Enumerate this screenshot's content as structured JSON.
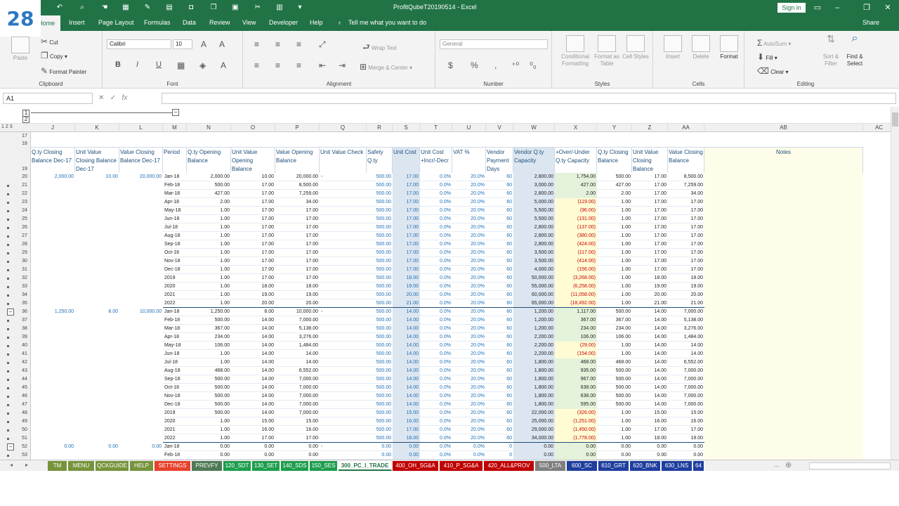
{
  "badge": "28",
  "window": {
    "title": "ProfitQubeT20190514  -  Excel",
    "sign_in": "Sign in"
  },
  "ribbon_tabs": [
    "Home",
    "Insert",
    "Page Layout",
    "Formulas",
    "Data",
    "Review",
    "View",
    "Developer",
    "Help"
  ],
  "tell_me": "Tell me what you want to do",
  "share": "Share",
  "clipboard": {
    "paste": "Paste",
    "cut": "Cut",
    "copy": "Copy",
    "format_painter": "Format Painter",
    "label": "Clipboard"
  },
  "font": {
    "name": "Calibri",
    "size": "10",
    "bold": "B",
    "italic": "I",
    "underline": "U",
    "label": "Font"
  },
  "alignment": {
    "wrap": "Wrap Text",
    "merge": "Merge & Center",
    "label": "Alignment"
  },
  "number": {
    "format": "General",
    "currency": "$",
    "percent": "%",
    "comma": ",",
    "label": "Number"
  },
  "styles": {
    "conditional": "Conditional Formatting",
    "format_table": "Format as Table",
    "cell_styles": "Cell Styles",
    "label": "Styles"
  },
  "cells": {
    "insert": "Insert",
    "delete": "Delete",
    "format": "Format",
    "label": "Cells"
  },
  "editing": {
    "autosum": "AutoSum",
    "fill": "Fill",
    "clear": "Clear",
    "sort": "Sort & Filter",
    "find": "Find & Select",
    "label": "Editing"
  },
  "formula_bar": {
    "name_box": "A1",
    "fx": "fx"
  },
  "outline_levels": [
    "1",
    "2",
    "3"
  ],
  "columns": [
    "J",
    "K",
    "L",
    "M",
    "N",
    "O",
    "P",
    "Q",
    "R",
    "S",
    "T",
    "U",
    "V",
    "W",
    "X",
    "Y",
    "Z",
    "AA",
    "AB",
    "AC"
  ],
  "rows": [
    "17",
    "18",
    "19",
    "20",
    "21",
    "22",
    "23",
    "24",
    "25",
    "26",
    "27",
    "28",
    "29",
    "30",
    "31",
    "32",
    "33",
    "34",
    "35",
    "36",
    "37",
    "38",
    "39",
    "40",
    "41",
    "42",
    "43",
    "44",
    "45",
    "46",
    "47",
    "48",
    "49",
    "50",
    "51",
    "52",
    "53"
  ],
  "headers": [
    "Q.ty Closing Balance Dec-17",
    "Unit Value Closing Balance Dec-17",
    "Value Closing Balance Dec-17",
    "Period",
    "Q.ty Opening Balance",
    "Unit Value Opening Balance",
    "Value Opening Balance",
    "Unit Value Check",
    "Safety Q.ty",
    "Unit Cost",
    "Unit Cost +Incr/-Decr",
    "VAT %",
    "Vendor Payment Days",
    "Vendor Q.ty Capacity",
    "+Over/-Under Q.ty Capacity",
    "Q.ty Closing Balance",
    "Unit Value Closing Balance",
    "Value Closing Balance",
    "Notes"
  ],
  "data_rows": [
    [
      "2,000.00",
      "10.00",
      "20,000.00",
      "Jan-18",
      "2,000.00",
      "10.00",
      "20,000.00",
      "-",
      "500.00",
      "17.00",
      "0.0%",
      "20.0%",
      "60",
      "2,800.00",
      "1,754.00",
      "500.00",
      "17.00",
      "8,500.00"
    ],
    [
      "",
      "",
      "",
      "Feb-18",
      "500.00",
      "17.00",
      "8,500.00",
      "",
      "500.00",
      "17.00",
      "0.0%",
      "20.0%",
      "60",
      "3,000.00",
      "427.00",
      "427.00",
      "17.00",
      "7,259.00"
    ],
    [
      "",
      "",
      "",
      "Mar-18",
      "427.00",
      "17.00",
      "7,259.00",
      "",
      "500.00",
      "17.00",
      "0.0%",
      "20.0%",
      "60",
      "2,800.00",
      "2.00",
      "2.00",
      "17.00",
      "34.00"
    ],
    [
      "",
      "",
      "",
      "Apr-18",
      "2.00",
      "17.00",
      "34.00",
      "",
      "500.00",
      "17.00",
      "0.0%",
      "20.0%",
      "60",
      "5,000.00",
      "(119.00)",
      "1.00",
      "17.00",
      "17.00"
    ],
    [
      "",
      "",
      "",
      "May-18",
      "1.00",
      "17.00",
      "17.00",
      "",
      "500.00",
      "17.00",
      "0.0%",
      "20.0%",
      "60",
      "5,500.00",
      "(96.00)",
      "1.00",
      "17.00",
      "17.00"
    ],
    [
      "",
      "",
      "",
      "Jun-18",
      "1.00",
      "17.00",
      "17.00",
      "",
      "500.00",
      "17.00",
      "0.0%",
      "20.0%",
      "60",
      "5,500.00",
      "(131.00)",
      "1.00",
      "17.00",
      "17.00"
    ],
    [
      "",
      "",
      "",
      "Jul-18",
      "1.00",
      "17.00",
      "17.00",
      "",
      "500.00",
      "17.00",
      "0.0%",
      "20.0%",
      "60",
      "2,800.00",
      "(137.00)",
      "1.00",
      "17.00",
      "17.00"
    ],
    [
      "",
      "",
      "",
      "Aug-18",
      "1.00",
      "17.00",
      "17.00",
      "",
      "500.00",
      "17.00",
      "0.0%",
      "20.0%",
      "60",
      "2,800.00",
      "(380.00)",
      "1.00",
      "17.00",
      "17.00"
    ],
    [
      "",
      "",
      "",
      "Sep-18",
      "1.00",
      "17.00",
      "17.00",
      "",
      "500.00",
      "17.00",
      "0.0%",
      "20.0%",
      "60",
      "2,800.00",
      "(424.00)",
      "1.00",
      "17.00",
      "17.00"
    ],
    [
      "",
      "",
      "",
      "Oct-18",
      "1.00",
      "17.00",
      "17.00",
      "",
      "500.00",
      "17.00",
      "0.0%",
      "20.0%",
      "60",
      "3,500.00",
      "(117.00)",
      "1.00",
      "17.00",
      "17.00"
    ],
    [
      "",
      "",
      "",
      "Nov-18",
      "1.00",
      "17.00",
      "17.00",
      "",
      "500.00",
      "17.00",
      "0.0%",
      "20.0%",
      "60",
      "3,500.00",
      "(414.00)",
      "1.00",
      "17.00",
      "17.00"
    ],
    [
      "",
      "",
      "",
      "Dec-18",
      "1.00",
      "17.00",
      "17.00",
      "",
      "500.00",
      "17.00",
      "0.0%",
      "20.0%",
      "60",
      "4,000.00",
      "(156.00)",
      "1.00",
      "17.00",
      "17.00"
    ],
    [
      "",
      "",
      "",
      "2019",
      "1.00",
      "17.00",
      "17.00",
      "",
      "500.00",
      "18.00",
      "0.0%",
      "20.0%",
      "60",
      "50,000.00",
      "(3,268.00)",
      "1.00",
      "18.00",
      "18.00"
    ],
    [
      "",
      "",
      "",
      "2020",
      "1.00",
      "18.00",
      "18.00",
      "",
      "500.00",
      "19.00",
      "0.0%",
      "20.0%",
      "60",
      "55,000.00",
      "(6,258.00)",
      "1.00",
      "19.00",
      "19.00"
    ],
    [
      "",
      "",
      "",
      "2021",
      "1.00",
      "19.00",
      "19.00",
      "",
      "500.00",
      "20.00",
      "0.0%",
      "20.0%",
      "60",
      "60,000.00",
      "(11,058.00)",
      "1.00",
      "20.00",
      "20.00"
    ],
    [
      "",
      "",
      "",
      "2022",
      "1.00",
      "20.00",
      "20.00",
      "",
      "500.00",
      "21.00",
      "0.0%",
      "20.0%",
      "60",
      "65,000.00",
      "(18,492.00)",
      "1.00",
      "21.00",
      "21.00"
    ],
    [
      "1,250.00",
      "8.00",
      "10,000.00",
      "Jan-18",
      "1,250.00",
      "8.00",
      "10,000.00",
      "-",
      "500.00",
      "14.00",
      "0.0%",
      "20.0%",
      "60",
      "1,200.00",
      "1,117.00",
      "500.00",
      "14.00",
      "7,000.00"
    ],
    [
      "",
      "",
      "",
      "Feb-18",
      "500.00",
      "14.00",
      "7,000.00",
      "",
      "500.00",
      "14.00",
      "0.0%",
      "20.0%",
      "60",
      "1,200.00",
      "367.00",
      "367.00",
      "14.00",
      "5,138.00"
    ],
    [
      "",
      "",
      "",
      "Mar-18",
      "367.00",
      "14.00",
      "5,138.00",
      "",
      "500.00",
      "14.00",
      "0.0%",
      "20.0%",
      "60",
      "1,200.00",
      "234.00",
      "234.00",
      "14.00",
      "3,276.00"
    ],
    [
      "",
      "",
      "",
      "Apr-18",
      "234.00",
      "14.00",
      "3,276.00",
      "",
      "500.00",
      "14.00",
      "0.0%",
      "20.0%",
      "60",
      "2,200.00",
      "106.00",
      "106.00",
      "14.00",
      "1,484.00"
    ],
    [
      "",
      "",
      "",
      "May-18",
      "106.00",
      "14.00",
      "1,484.00",
      "",
      "500.00",
      "14.00",
      "0.0%",
      "20.0%",
      "60",
      "2,200.00",
      "(29.00)",
      "1.00",
      "14.00",
      "14.00"
    ],
    [
      "",
      "",
      "",
      "Jun-18",
      "1.00",
      "14.00",
      "14.00",
      "",
      "500.00",
      "14.00",
      "0.0%",
      "20.0%",
      "60",
      "2,200.00",
      "(154.00)",
      "1.00",
      "14.00",
      "14.00"
    ],
    [
      "",
      "",
      "",
      "Jul-18",
      "1.00",
      "14.00",
      "14.00",
      "",
      "500.00",
      "14.00",
      "0.0%",
      "20.0%",
      "60",
      "1,800.00",
      "468.00",
      "468.00",
      "14.00",
      "6,552.00"
    ],
    [
      "",
      "",
      "",
      "Aug-18",
      "468.00",
      "14.00",
      "6,552.00",
      "",
      "500.00",
      "14.00",
      "0.0%",
      "20.0%",
      "60",
      "1,800.00",
      "935.00",
      "500.00",
      "14.00",
      "7,000.00"
    ],
    [
      "",
      "",
      "",
      "Sep-18",
      "500.00",
      "14.00",
      "7,000.00",
      "",
      "500.00",
      "14.00",
      "0.0%",
      "20.0%",
      "60",
      "1,800.00",
      "967.00",
      "500.00",
      "14.00",
      "7,000.00"
    ],
    [
      "",
      "",
      "",
      "Oct-18",
      "500.00",
      "14.00",
      "7,000.00",
      "",
      "500.00",
      "14.00",
      "0.0%",
      "20.0%",
      "60",
      "1,800.00",
      "638.00",
      "500.00",
      "14.00",
      "7,000.00"
    ],
    [
      "",
      "",
      "",
      "Nov-18",
      "500.00",
      "14.00",
      "7,000.00",
      "",
      "500.00",
      "14.00",
      "0.0%",
      "20.0%",
      "60",
      "1,800.00",
      "638.00",
      "500.00",
      "14.00",
      "7,000.00"
    ],
    [
      "",
      "",
      "",
      "Dec-18",
      "500.00",
      "14.00",
      "7,000.00",
      "",
      "500.00",
      "14.00",
      "0.0%",
      "20.0%",
      "60",
      "1,800.00",
      "595.00",
      "500.00",
      "14.00",
      "7,000.00"
    ],
    [
      "",
      "",
      "",
      "2019",
      "500.00",
      "14.00",
      "7,000.00",
      "",
      "500.00",
      "15.00",
      "0.0%",
      "20.0%",
      "60",
      "22,000.00",
      "(326.00)",
      "1.00",
      "15.00",
      "15.00"
    ],
    [
      "",
      "",
      "",
      "2020",
      "1.00",
      "15.00",
      "15.00",
      "",
      "500.00",
      "16.00",
      "0.0%",
      "20.0%",
      "60",
      "25,000.00",
      "(1,251.00)",
      "1.00",
      "16.00",
      "16.00"
    ],
    [
      "",
      "",
      "",
      "2021",
      "1.00",
      "16.00",
      "16.00",
      "",
      "500.00",
      "17.00",
      "0.0%",
      "20.0%",
      "60",
      "29,000.00",
      "(1,450.00)",
      "1.00",
      "17.00",
      "17.00"
    ],
    [
      "",
      "",
      "",
      "2022",
      "1.00",
      "17.00",
      "17.00",
      "",
      "500.00",
      "18.00",
      "0.0%",
      "20.0%",
      "60",
      "34,000.00",
      "(1,778.00)",
      "1.00",
      "18.00",
      "18.00"
    ],
    [
      "0.00",
      "0.00",
      "0.00",
      "Jan-18",
      "0.00",
      "0.00",
      "0.00",
      "-",
      "0.00",
      "0.00",
      "0.0%",
      "0.0%",
      "0",
      "0.00",
      "0.00",
      "0.00",
      "0.00",
      "0.00"
    ],
    [
      "",
      "",
      "",
      "Feb-18",
      "0.00",
      "0.00",
      "0.00",
      "",
      "0.00",
      "0.00",
      "0.0%",
      "0.0%",
      "0",
      "0.00",
      "0.00",
      "0.00",
      "0.00",
      "0.00"
    ]
  ],
  "sheet_tabs": [
    {
      "name": "TM",
      "color": "#77933c"
    },
    {
      "name": "MENU",
      "color": "#77933c"
    },
    {
      "name": "QCKGUIDE",
      "color": "#77933c"
    },
    {
      "name": "HELP",
      "color": "#77933c"
    },
    {
      "name": "SETTINGS",
      "color": "#e8412c"
    },
    {
      "name": "PREVFY",
      "color": "#4f7a55"
    },
    {
      "name": "120_SDT",
      "color": "#1e9e4e"
    },
    {
      "name": "130_SET",
      "color": "#1e9e4e"
    },
    {
      "name": "140_SDS",
      "color": "#1e9e4e"
    },
    {
      "name": "150_SES",
      "color": "#1e9e4e"
    },
    {
      "name": "300_PC_I_TRADE",
      "color": "#ffffff"
    },
    {
      "name": "400_OH_SG&A",
      "color": "#c00000"
    },
    {
      "name": "410_P_SG&A",
      "color": "#c00000"
    },
    {
      "name": "420_ALL&PROV",
      "color": "#c00000"
    },
    {
      "name": "500_LTA",
      "color": "#7f7f7f"
    },
    {
      "name": "600_SC",
      "color": "#1f3f9f"
    },
    {
      "name": "610_GRT",
      "color": "#1f3f9f"
    },
    {
      "name": "620_BNK",
      "color": "#1f3f9f"
    },
    {
      "name": "630_LNS",
      "color": "#1f3f9f"
    },
    {
      "name": "64",
      "color": "#1f3f9f"
    }
  ],
  "sheet_more": "..."
}
